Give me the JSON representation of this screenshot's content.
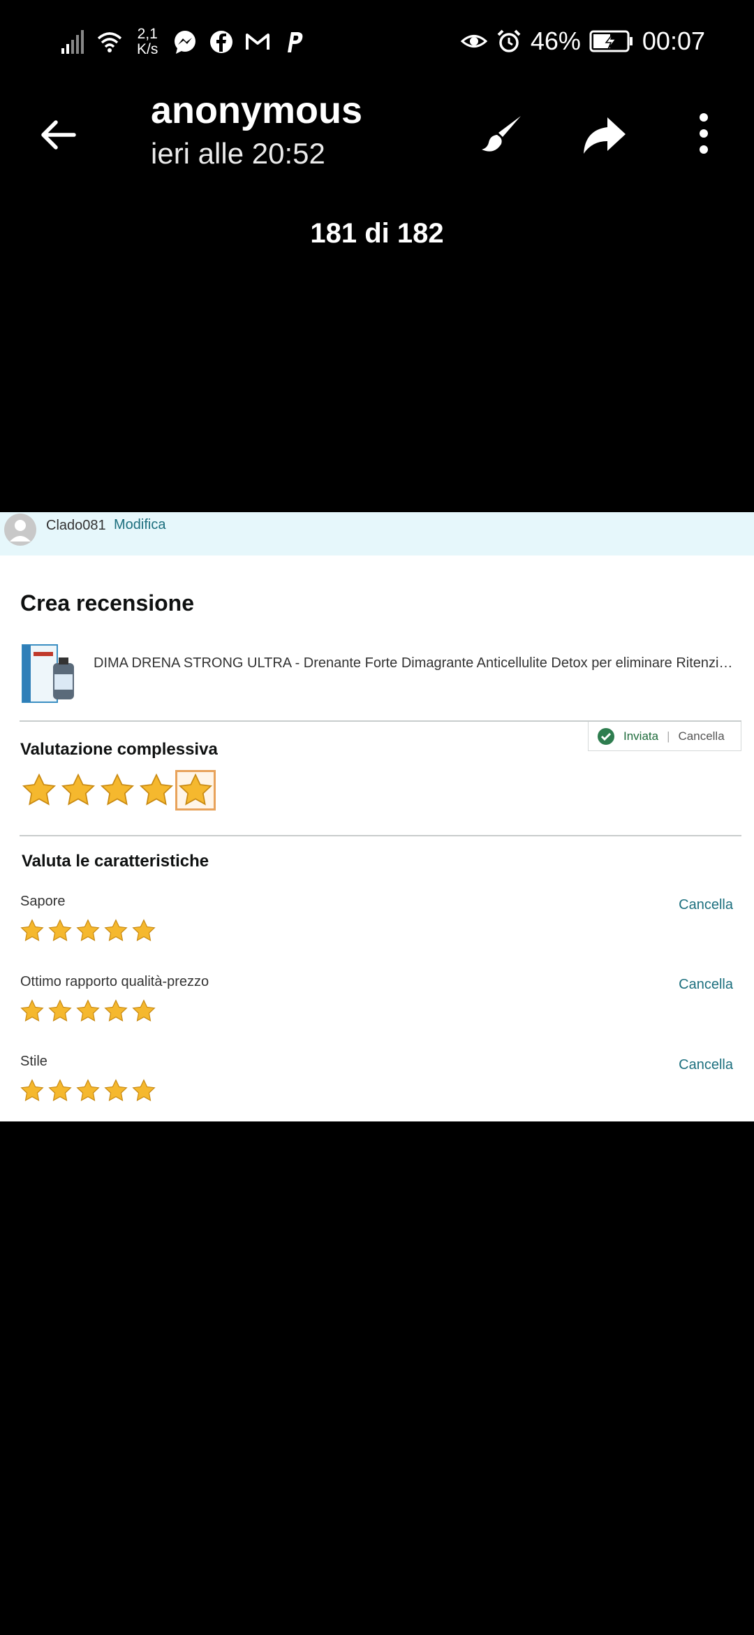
{
  "status_bar": {
    "net_speed_value": "2,1",
    "net_speed_unit": "K/s",
    "notification_icons": [
      "messenger-icon",
      "facebook-icon",
      "gmail-icon",
      "paypal-icon"
    ],
    "battery": "46%",
    "time": "00:07"
  },
  "viewer": {
    "title": "anonymous",
    "subtitle": "ieri alle 20:52",
    "counter": "181 di 182"
  },
  "review_page": {
    "user_name": "Clado081",
    "modify_label": "Modifica",
    "heading": "Crea recensione",
    "product_title": "DIMA DRENA STRONG ULTRA - Drenante Forte Dimagrante Anticellulite Detox per eliminare Ritenzione Idrica",
    "status_sent": "Inviata",
    "status_cancel": "Cancella",
    "overall_label": "Valutazione complessiva",
    "overall_rating": 5,
    "features_label": "Valuta le caratteristiche",
    "features": [
      {
        "label": "Sapore",
        "rating": 5,
        "cancel": "Cancella"
      },
      {
        "label": "Ottimo rapporto qualità-prezzo",
        "rating": 5,
        "cancel": "Cancella"
      },
      {
        "label": "Stile",
        "rating": 5,
        "cancel": "Cancella"
      }
    ],
    "colors": {
      "star": "#f5b82e",
      "link": "#1c6f7e",
      "header_bg": "#e6f7fb"
    }
  }
}
